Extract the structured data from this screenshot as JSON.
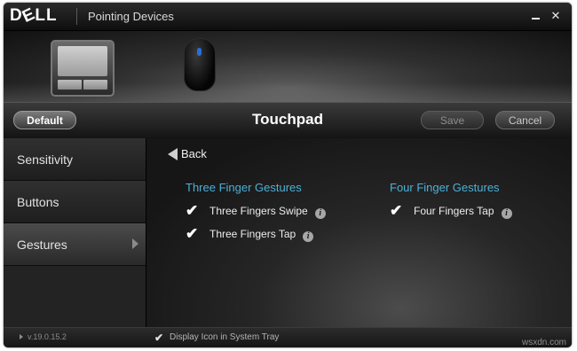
{
  "titlebar": {
    "logo": "DELL",
    "logo_e": "E",
    "title": "Pointing Devices",
    "close_glyph": "✕"
  },
  "toolbar": {
    "default_label": "Default",
    "heading": "Touchpad",
    "save_label": "Save",
    "cancel_label": "Cancel"
  },
  "sidebar": {
    "items": [
      {
        "label": "Sensitivity"
      },
      {
        "label": "Buttons"
      },
      {
        "label": "Gestures",
        "active": true
      }
    ]
  },
  "content": {
    "back_label": "Back",
    "groups": [
      {
        "title": "Three Finger Gestures",
        "options": [
          {
            "label": "Three Fingers Swipe",
            "checked": true
          },
          {
            "label": "Three Fingers Tap",
            "checked": true
          }
        ]
      },
      {
        "title": "Four Finger Gestures",
        "options": [
          {
            "label": "Four Fingers Tap",
            "checked": true
          }
        ]
      }
    ],
    "info_glyph": "i",
    "check_glyph": "✔"
  },
  "statusbar": {
    "version": "v.19.0.15.2",
    "tray_label": "Display Icon in System Tray",
    "tray_checked": true,
    "check_glyph": "✔"
  },
  "watermark": "wsxdn.com",
  "colors": {
    "group_title": "#4db0d6",
    "background": "#1a1a1a"
  }
}
